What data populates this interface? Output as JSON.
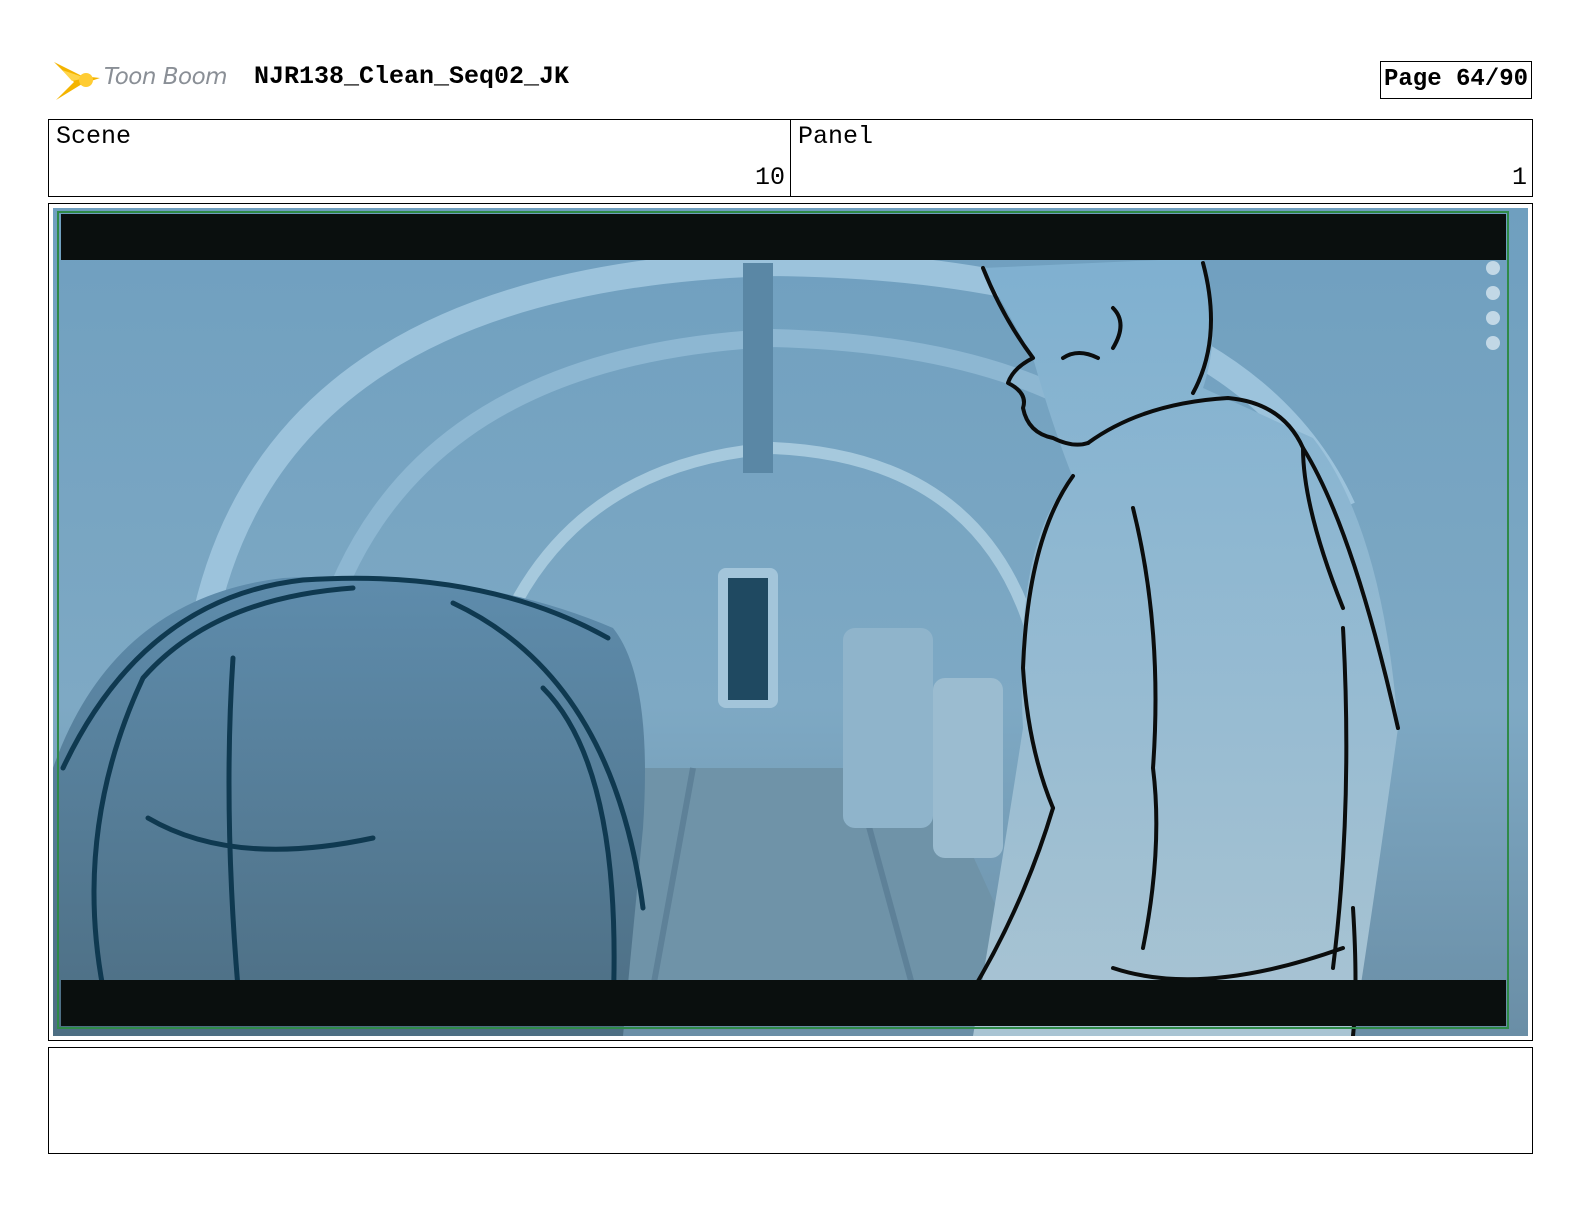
{
  "header": {
    "logo_text": "Toon Boom",
    "project_title": "NJR138_Clean_Seq02_JK",
    "page_label": "Page 64/90"
  },
  "info": {
    "scene_label": "Scene",
    "scene_value": "10",
    "panel_label": "Panel",
    "panel_value": "1"
  },
  "panel": {
    "tint_color": "#7ba7c6",
    "letterbox_color": "#0a0f0e",
    "frame_color": "#2f8a48"
  },
  "notes": {
    "text": ""
  }
}
